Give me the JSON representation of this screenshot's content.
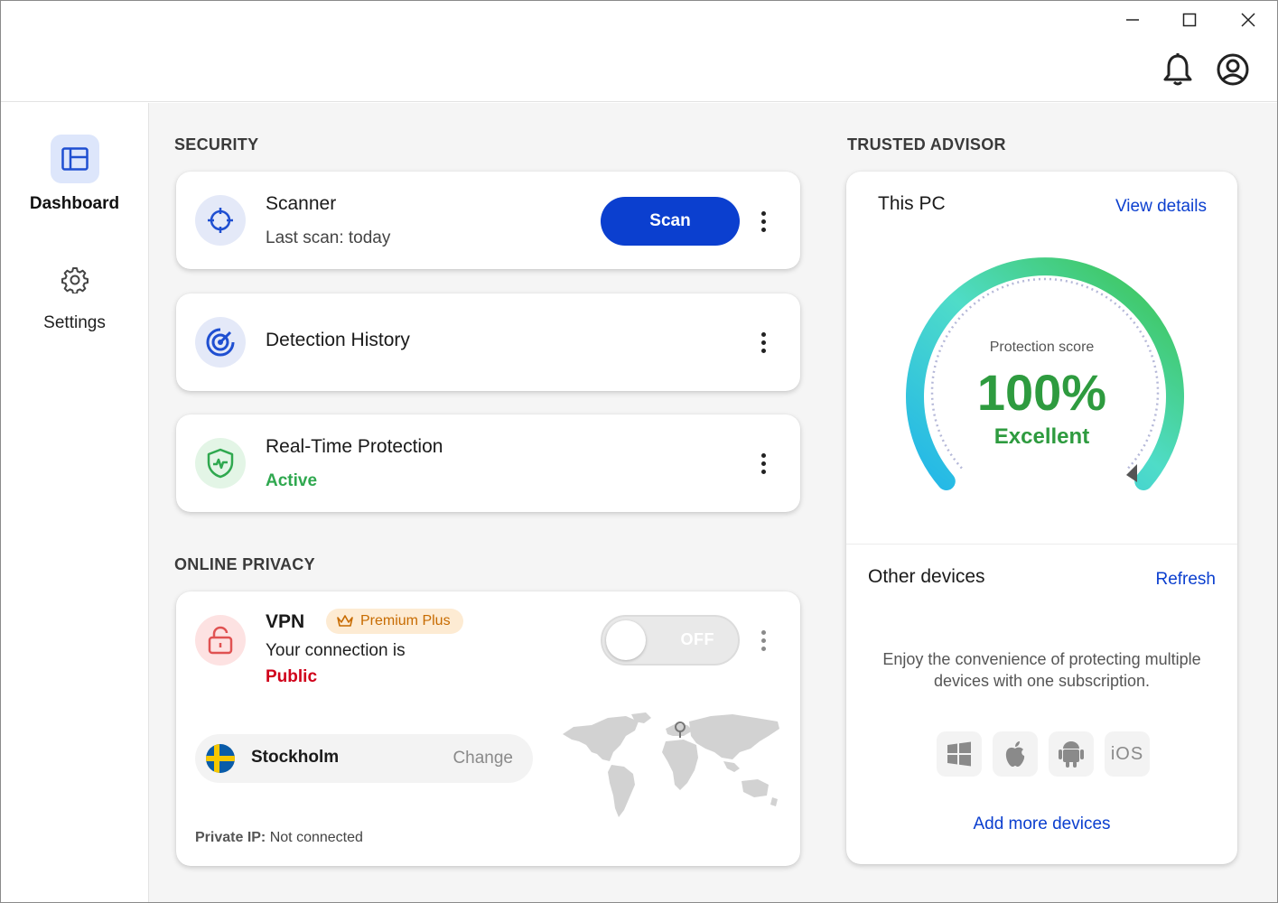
{
  "window": {
    "minimize_icon": "minimize-icon",
    "maximize_icon": "maximize-icon",
    "close_icon": "close-icon"
  },
  "header": {
    "notifications_icon": "bell-icon",
    "account_icon": "user-circle-icon"
  },
  "sidebar": {
    "items": [
      {
        "label": "Dashboard",
        "icon": "dashboard-icon",
        "active": true
      },
      {
        "label": "Settings",
        "icon": "gear-icon",
        "active": false
      }
    ]
  },
  "security": {
    "title": "SECURITY",
    "scanner": {
      "title": "Scanner",
      "subtitle": "Last scan: today",
      "button": "Scan",
      "icon": "crosshair-icon"
    },
    "detection_history": {
      "title": "Detection History",
      "icon": "radar-icon"
    },
    "realtime": {
      "title": "Real-Time Protection",
      "status": "Active",
      "icon": "shield-pulse-icon"
    }
  },
  "privacy": {
    "title": "ONLINE PRIVACY",
    "vpn": {
      "title": "VPN",
      "badge": "Premium Plus",
      "connection_text": "Your connection is",
      "connection_status": "Public",
      "toggle_label": "OFF",
      "toggle_on": false,
      "location": "Stockholm",
      "change_label": "Change",
      "private_ip_label": "Private IP:",
      "private_ip_value": "Not connected",
      "icon": "unlocked-lock-icon"
    }
  },
  "advisor": {
    "title": "TRUSTED ADVISOR",
    "this_pc": "This PC",
    "view_details": "View details",
    "score_label": "Protection score",
    "score_value": "100%",
    "score_text": "Excellent",
    "score_fraction": 1.0,
    "other_devices": "Other devices",
    "refresh": "Refresh",
    "description": "Enjoy the convenience of protecting multiple devices with one subscription.",
    "platforms": [
      "windows-icon",
      "apple-icon",
      "android-icon",
      "iOS"
    ],
    "ios_label": "iOS",
    "add_devices": "Add more devices"
  },
  "colors": {
    "accent": "#0b3fcf",
    "active_green": "#2fa84f",
    "public_red": "#d0021b",
    "score_green": "#2e9b3f",
    "badge_bg": "#fdebd3",
    "badge_text": "#c76b00"
  }
}
